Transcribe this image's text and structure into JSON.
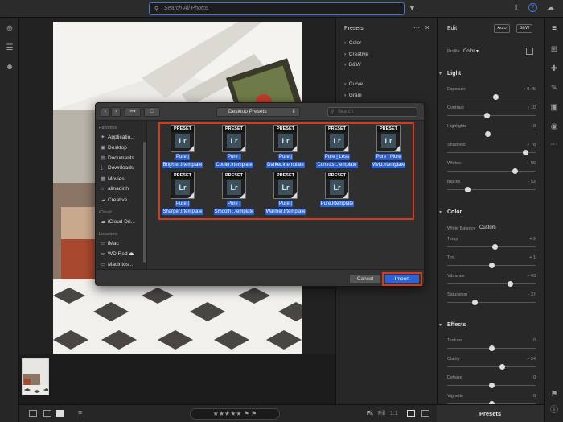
{
  "search": {
    "placeholder": "Search All Photos"
  },
  "presets_panel": {
    "title": "Presets",
    "groups": [
      "Color",
      "Creative",
      "B&W",
      "Curve",
      "Grain"
    ]
  },
  "edit_panel": {
    "title": "Edit",
    "auto_label": "Auto",
    "bw_label": "B&W",
    "profile_label": "Profile",
    "profile_value": "Color",
    "light": {
      "title": "Light",
      "sliders": [
        {
          "label": "Exposure",
          "value": "+ 0.45",
          "level": 0.55
        },
        {
          "label": "Contrast",
          "value": "- 10",
          "level": 0.45
        },
        {
          "label": "Highlights",
          "value": "- 8",
          "level": 0.46
        },
        {
          "label": "Shadows",
          "value": "+ 78",
          "level": 0.89
        },
        {
          "label": "Whites",
          "value": "+ 55",
          "level": 0.77
        },
        {
          "label": "Blacks",
          "value": "- 53",
          "level": 0.23
        }
      ]
    },
    "color": {
      "title": "Color",
      "white_balance_label": "White Balance",
      "white_balance_value": "Custom",
      "sliders": [
        {
          "label": "Temp",
          "value": "+ 9",
          "level": 0.54
        },
        {
          "label": "Tint",
          "value": "+ 1",
          "level": 0.5
        },
        {
          "label": "Vibrance",
          "value": "+ 43",
          "level": 0.71
        },
        {
          "label": "Saturation",
          "value": "- 37",
          "level": 0.31
        }
      ]
    },
    "effects": {
      "title": "Effects",
      "sliders": [
        {
          "label": "Texture",
          "value": "0",
          "level": 0.5
        },
        {
          "label": "Clarity",
          "value": "+ 24",
          "level": 0.62
        },
        {
          "label": "Dehaze",
          "value": "0",
          "level": 0.5
        },
        {
          "label": "Vignette",
          "value": "0",
          "level": 0.5
        }
      ]
    }
  },
  "bottom_bar": {
    "fit": "Fit",
    "fill": "Fill",
    "one_to_one": "1:1",
    "presets_button": "Presets"
  },
  "dialog": {
    "location": "Desktop Presets",
    "search_placeholder": "Search",
    "sidebar": {
      "favorites_header": "Favorites",
      "favorites": [
        "Applicatio...",
        "Desktop",
        "Documents",
        "Downloads",
        "Movies",
        "alinadinh",
        "Creative..."
      ],
      "icloud_header": "iCloud",
      "icloud": [
        "iCloud Dri..."
      ],
      "locations_header": "Locations",
      "locations": [
        "iMac",
        "WD Red",
        "Macintos..."
      ]
    },
    "file_badge": "PRESET",
    "file_icon_text": "Lr",
    "files": [
      {
        "line1": "Pure |",
        "line2": "Brighter.lrtemplate"
      },
      {
        "line1": "Pure |",
        "line2": "Cooler.lrtemplate"
      },
      {
        "line1": "Pure |",
        "line2": "Darker.lrtemplate"
      },
      {
        "line1": "Pure | Less",
        "line2": "Contras...template"
      },
      {
        "line1": "Pure | More",
        "line2": "Vivid.lrtemplate"
      },
      {
        "line1": "Pure |",
        "line2": "Sharper.lrtemplate"
      },
      {
        "line1": "Pure |",
        "line2": "Smooth...template"
      },
      {
        "line1": "Pure |",
        "line2": "Warmer.lrtemplate"
      },
      {
        "line1": "Pure.lrtemplate",
        "line2": ""
      }
    ],
    "cancel_label": "Cancel",
    "import_label": "Import"
  }
}
